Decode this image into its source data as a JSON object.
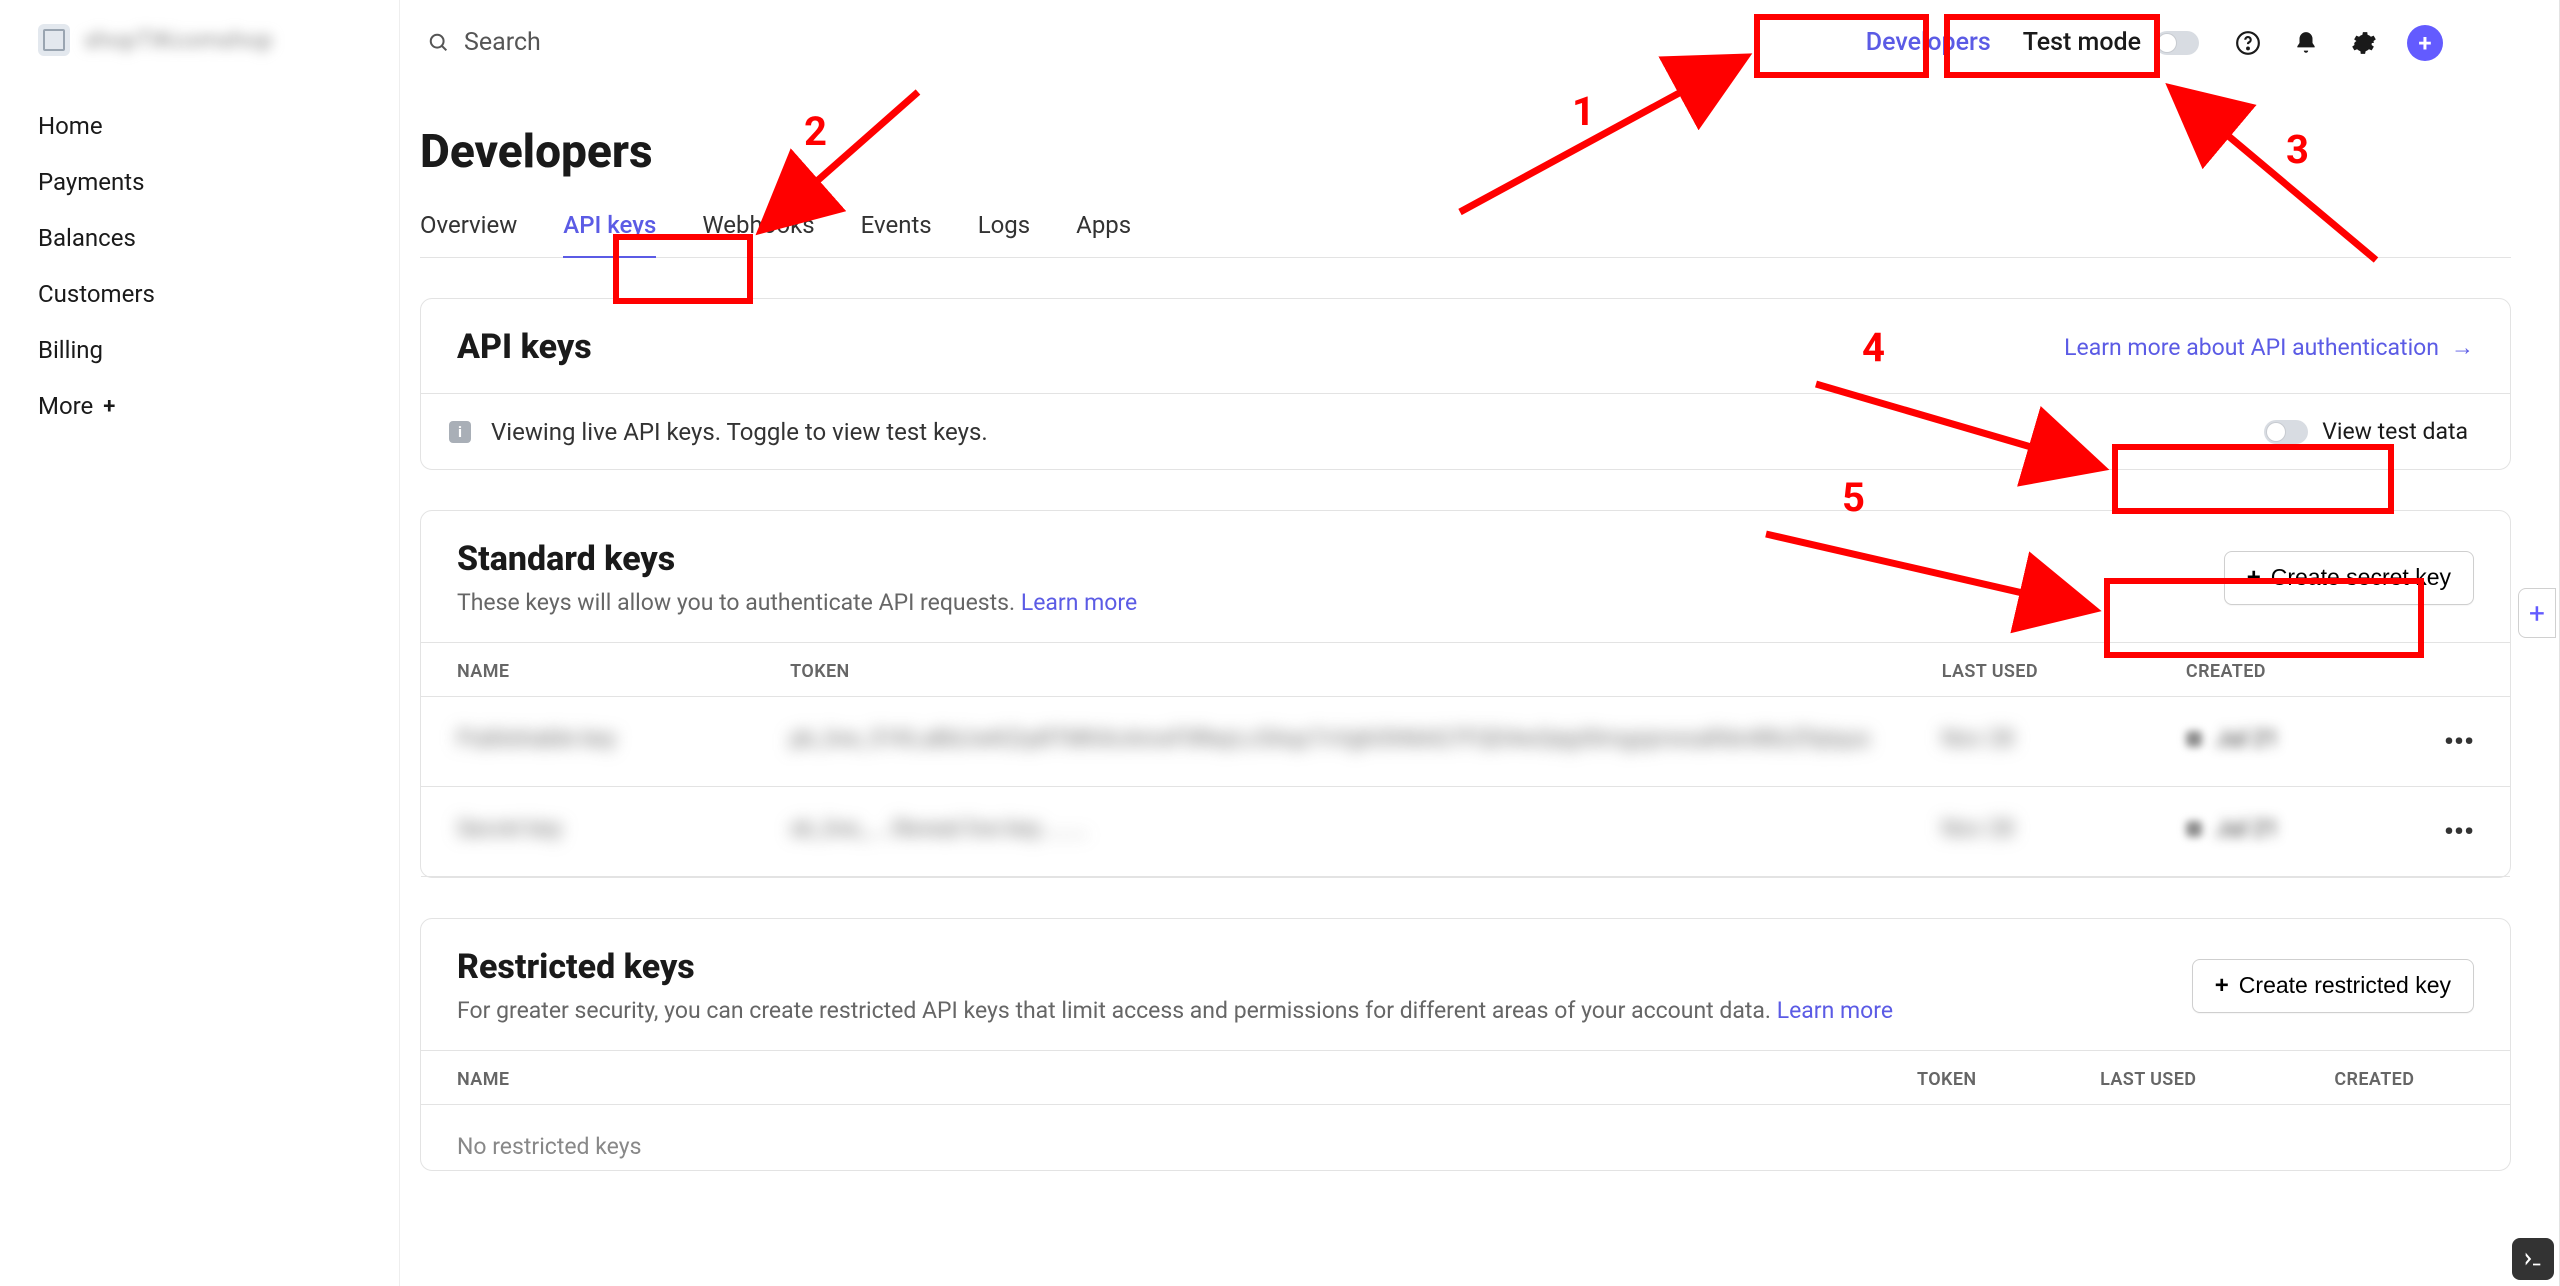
{
  "brand_name": "shopTIKcomshop",
  "search_placeholder": "Search",
  "top": {
    "developers": "Developers",
    "test_mode": "Test mode"
  },
  "avatar_glyph": "+",
  "sidebar": {
    "items": [
      {
        "label": "Home"
      },
      {
        "label": "Payments"
      },
      {
        "label": "Balances"
      },
      {
        "label": "Customers"
      },
      {
        "label": "Billing"
      },
      {
        "label": "More"
      }
    ]
  },
  "page_title": "Developers",
  "tabs": [
    {
      "label": "Overview"
    },
    {
      "label": "API keys"
    },
    {
      "label": "Webhooks"
    },
    {
      "label": "Events"
    },
    {
      "label": "Logs"
    },
    {
      "label": "Apps"
    }
  ],
  "active_tab_index": 1,
  "api_keys": {
    "title": "API keys",
    "learn_link": "Learn more about API authentication",
    "notice": "Viewing live API keys. Toggle to view test keys.",
    "view_test": "View test data"
  },
  "standard": {
    "title": "Standard keys",
    "sub_prefix": "These keys will allow you to authenticate API requests. ",
    "sub_link": "Learn more",
    "create_btn": "Create secret key",
    "columns": {
      "name": "NAME",
      "token": "TOKEN",
      "last": "LAST USED",
      "created": "CREATED"
    },
    "rows": [
      {
        "name": "Publishable key",
        "token": "pk_live_51KLaBdJwKZq4lTMhXcAmxF0ReyLc5Aqz7vVghOhNAG7FQD4wQejy0tmgzprwsalhbn88zZfqtqus",
        "last": "Nov 28",
        "created": "Jul 21"
      },
      {
        "name": "Secret key",
        "token": "sk_live_....Reveal live key........",
        "last": "Nov 28",
        "created": "Jul 21"
      }
    ]
  },
  "restricted": {
    "title": "Restricted keys",
    "sub_prefix": "For greater security, you can create restricted API keys that limit access and permissions for different areas of your account data. ",
    "sub_link": "Learn more",
    "create_btn": "Create restricted key",
    "columns": {
      "name": "NAME",
      "token": "TOKEN",
      "last": "LAST USED",
      "created": "CREATED"
    },
    "empty": "No restricted keys"
  },
  "annotations": {
    "n1": "1",
    "n2": "2",
    "n3": "3",
    "n4": "4",
    "n5": "5"
  },
  "colors": {
    "accent": "#5b5be5",
    "red": "#ff0000"
  }
}
